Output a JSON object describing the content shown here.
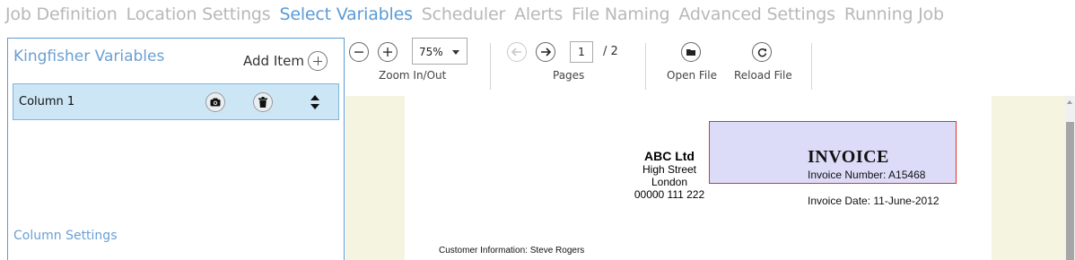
{
  "tabs": [
    {
      "label": "Job Definition",
      "active": false
    },
    {
      "label": "Location Settings",
      "active": false
    },
    {
      "label": "Select Variables",
      "active": true
    },
    {
      "label": "Scheduler",
      "active": false
    },
    {
      "label": "Alerts",
      "active": false
    },
    {
      "label": "File Naming",
      "active": false
    },
    {
      "label": "Advanced Settings",
      "active": false
    },
    {
      "label": "Running Job",
      "active": false
    }
  ],
  "variables_panel": {
    "title": "Kingfisher Variables",
    "add_item_label": "Add Item",
    "add_item_icon": "plus-circle-icon",
    "columns": [
      {
        "label": "Column 1",
        "icons": [
          "camera-icon",
          "trash-icon",
          "sort-icon"
        ]
      }
    ],
    "column_settings_label": "Column Settings"
  },
  "toolbar": {
    "zoom": {
      "label": "Zoom In/Out",
      "value": "75%",
      "out_icon": "minus-icon",
      "in_icon": "plus-icon"
    },
    "pages": {
      "label": "Pages",
      "current": "1",
      "total": "/ 2",
      "prev_icon": "arrow-left-icon",
      "next_icon": "arrow-right-icon"
    },
    "open_file": {
      "label": "Open File",
      "icon": "folder-icon"
    },
    "reload_file": {
      "label": "Reload File",
      "icon": "reload-icon"
    }
  },
  "document": {
    "company_name": "ABC Ltd",
    "address": [
      "High Street",
      "London",
      "00000 111 222"
    ],
    "invoice_title": "INVOICE",
    "invoice_number": "Invoice Number: A15468",
    "invoice_date": "Invoice Date: 11-June-2012",
    "customer_info": "Customer Information: Steve Rogers"
  },
  "colors": {
    "accent": "#5b9bd5",
    "selected_row": "#cde6f5",
    "viewer_bg": "#f4f4e1",
    "highlight": "#dcdcf8",
    "highlight_border": "#dd3333"
  }
}
